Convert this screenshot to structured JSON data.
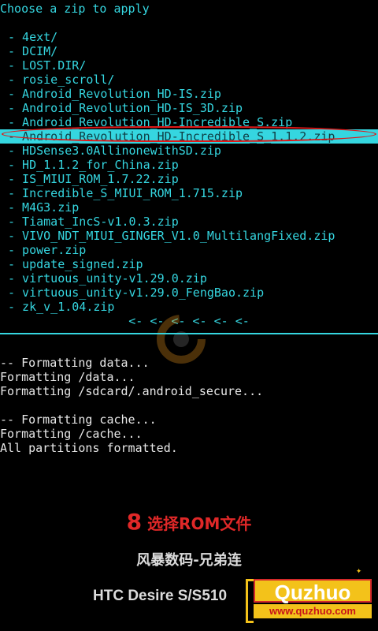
{
  "recovery": {
    "title": "Choose a zip to apply",
    "items": [
      "- 4ext/",
      "- DCIM/",
      "- LOST.DIR/",
      "- rosie_scroll/",
      "- Android_Revolution_HD-IS.zip",
      "- Android_Revolution_HD-IS_3D.zip",
      "- Android_Revolution_HD-Incredible_S.zip",
      "- Android_Revolution_HD-Incredible_S_1.1.2.zip",
      "- HDSense3.0AllinonewithSD.zip",
      "- HD_1.1.2_for_China.zip",
      "- IS_MIUI_ROM_1.7.22.zip",
      "- Incredible_S_MIUI_ROM_1.715.zip",
      "- M4G3.zip",
      "- Tiamat_IncS-v1.0.3.zip",
      "- VIVO_NDT_MIUI_GINGER_V1.0_MultilangFixed.zip",
      "- power.zip",
      "- update_signed.zip",
      "- virtuous_unity-v1.29.0.zip",
      "- virtuous_unity-v1.29.0_FengBao.zip",
      "- zk_v_1.04.zip"
    ],
    "selected_index": 7,
    "back_arrows": "<- <- <- <- <- <-"
  },
  "log": {
    "lines": [
      "-- Formatting data...",
      "Formatting /data...",
      "Formatting /sdcard/.android_secure...",
      "",
      "-- Formatting cache...",
      "Formatting /cache...",
      "All partitions formatted."
    ]
  },
  "captions": {
    "step_number": "8",
    "step_text": "选择ROM文件",
    "subtitle": "风暴数码-兄弟连",
    "device": "HTC Desire S/S510"
  },
  "brand": {
    "name": "Quzhuo",
    "url": "www.quzhuo.com"
  },
  "colors": {
    "accent": "#35d6e0",
    "selected_text": "#0f3e44",
    "ring": "#e01818",
    "caption_red": "#e02828",
    "brand_yellow": "#f3c21a"
  }
}
